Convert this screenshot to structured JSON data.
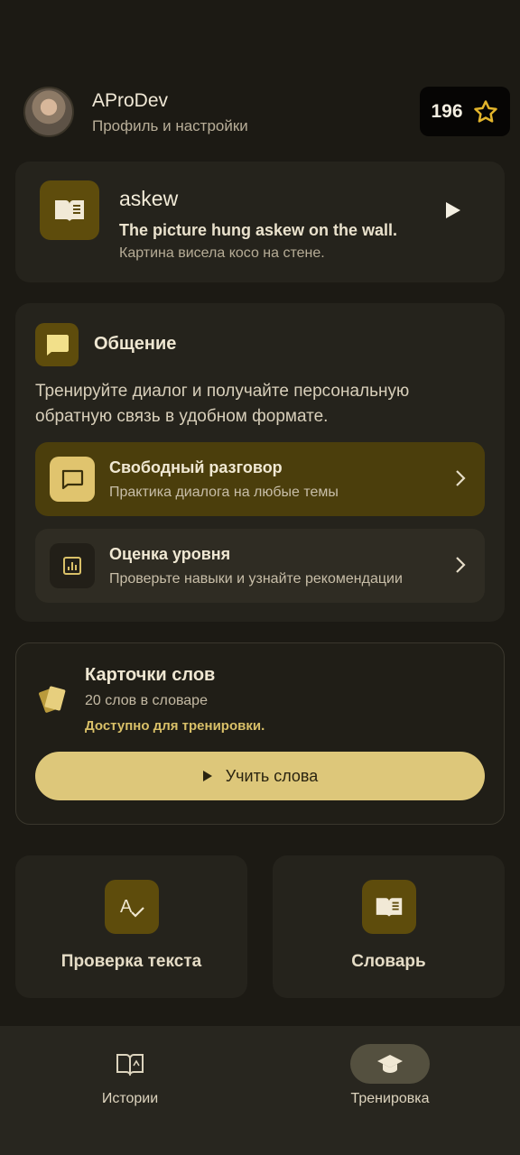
{
  "header": {
    "username": "AProDev",
    "subtitle": "Профиль и настройки",
    "points": "196"
  },
  "word_card": {
    "word": "askew",
    "sentence": "The picture hung askew on the wall.",
    "translation": "Картина висела косо на стене."
  },
  "communication": {
    "title": "Общение",
    "description": "Тренируйте диалог и получайте персональную обратную связь в удобном формате.",
    "options": [
      {
        "title": "Свободный разговор",
        "subtitle": "Практика диалога на любые темы"
      },
      {
        "title": "Оценка уровня",
        "subtitle": "Проверьте навыки и узнайте рекомендации"
      }
    ]
  },
  "flashcards": {
    "title": "Карточки слов",
    "count": "20 слов в словаре",
    "status": "Доступно для тренировки.",
    "button_label": "Учить слова"
  },
  "tiles": [
    {
      "label": "Проверка текста",
      "icon": "spellcheck-icon"
    },
    {
      "label": "Словарь",
      "icon": "book-icon"
    }
  ],
  "nav": {
    "items": [
      {
        "label": "Истории",
        "icon": "stories-book-icon",
        "active": false
      },
      {
        "label": "Тренировка",
        "icon": "graduation-cap-icon",
        "active": true
      }
    ]
  },
  "colors": {
    "background": "#1c1a14",
    "card": "#25231c",
    "accent": "#ddc77a",
    "accent_dark": "#5e4c0c"
  }
}
